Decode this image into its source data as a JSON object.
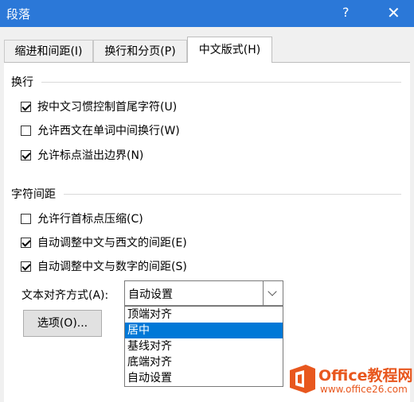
{
  "dialog": {
    "title": "段落",
    "help": "?",
    "close": "✕"
  },
  "tabs": [
    {
      "label": "缩进和间距(I)"
    },
    {
      "label": "换行和分页(P)"
    },
    {
      "label": "中文版式(H)"
    }
  ],
  "line_break": {
    "header": "换行",
    "options": [
      {
        "label": "按中文习惯控制首尾字符(U)",
        "checked": true
      },
      {
        "label": "允许西文在单词中间换行(W)",
        "checked": false
      },
      {
        "label": "允许标点溢出边界(N)",
        "checked": true
      }
    ]
  },
  "char_spacing": {
    "header": "字符间距",
    "options": [
      {
        "label": "允许行首标点压缩(C)",
        "checked": false
      },
      {
        "label": "自动调整中文与西文的间距(E)",
        "checked": true
      },
      {
        "label": "自动调整中文与数字的间距(S)",
        "checked": true
      }
    ]
  },
  "text_alignment": {
    "label": "文本对齐方式(A):",
    "value": "自动设置",
    "dropdown_items": [
      "顶端对齐",
      "居中",
      "基线对齐",
      "底端对齐",
      "自动设置"
    ],
    "highlighted_item": "居中"
  },
  "options_button": "选项(O)...",
  "watermark": {
    "brand": "Office教程网",
    "url": "www.office26.com",
    "color": "#e8571e"
  },
  "colors": {
    "title_bar": "#2b78d8",
    "selection": "#0078d7"
  }
}
